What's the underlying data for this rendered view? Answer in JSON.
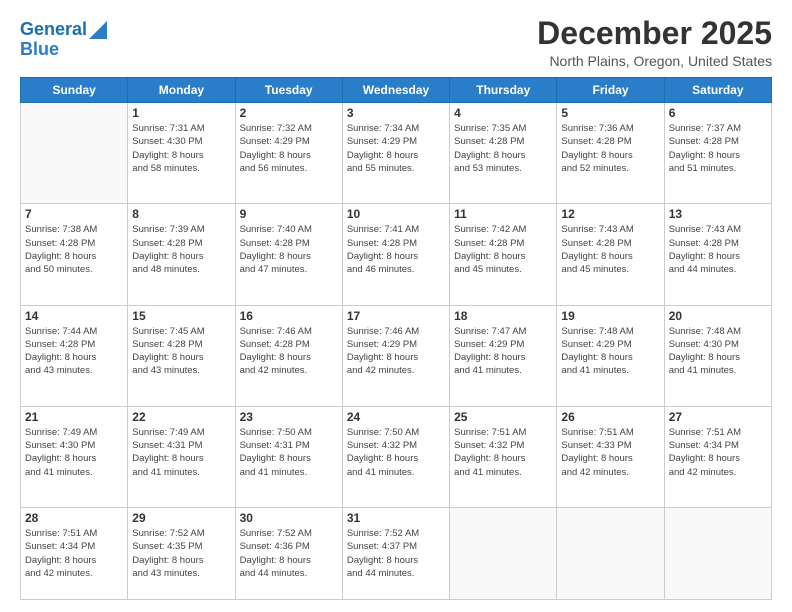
{
  "header": {
    "logo_line1": "General",
    "logo_line2": "Blue",
    "month": "December 2025",
    "location": "North Plains, Oregon, United States"
  },
  "days_of_week": [
    "Sunday",
    "Monday",
    "Tuesday",
    "Wednesday",
    "Thursday",
    "Friday",
    "Saturday"
  ],
  "weeks": [
    [
      {
        "day": "",
        "info": ""
      },
      {
        "day": "1",
        "info": "Sunrise: 7:31 AM\nSunset: 4:30 PM\nDaylight: 8 hours\nand 58 minutes."
      },
      {
        "day": "2",
        "info": "Sunrise: 7:32 AM\nSunset: 4:29 PM\nDaylight: 8 hours\nand 56 minutes."
      },
      {
        "day": "3",
        "info": "Sunrise: 7:34 AM\nSunset: 4:29 PM\nDaylight: 8 hours\nand 55 minutes."
      },
      {
        "day": "4",
        "info": "Sunrise: 7:35 AM\nSunset: 4:28 PM\nDaylight: 8 hours\nand 53 minutes."
      },
      {
        "day": "5",
        "info": "Sunrise: 7:36 AM\nSunset: 4:28 PM\nDaylight: 8 hours\nand 52 minutes."
      },
      {
        "day": "6",
        "info": "Sunrise: 7:37 AM\nSunset: 4:28 PM\nDaylight: 8 hours\nand 51 minutes."
      }
    ],
    [
      {
        "day": "7",
        "info": "Sunrise: 7:38 AM\nSunset: 4:28 PM\nDaylight: 8 hours\nand 50 minutes."
      },
      {
        "day": "8",
        "info": "Sunrise: 7:39 AM\nSunset: 4:28 PM\nDaylight: 8 hours\nand 48 minutes."
      },
      {
        "day": "9",
        "info": "Sunrise: 7:40 AM\nSunset: 4:28 PM\nDaylight: 8 hours\nand 47 minutes."
      },
      {
        "day": "10",
        "info": "Sunrise: 7:41 AM\nSunset: 4:28 PM\nDaylight: 8 hours\nand 46 minutes."
      },
      {
        "day": "11",
        "info": "Sunrise: 7:42 AM\nSunset: 4:28 PM\nDaylight: 8 hours\nand 45 minutes."
      },
      {
        "day": "12",
        "info": "Sunrise: 7:43 AM\nSunset: 4:28 PM\nDaylight: 8 hours\nand 45 minutes."
      },
      {
        "day": "13",
        "info": "Sunrise: 7:43 AM\nSunset: 4:28 PM\nDaylight: 8 hours\nand 44 minutes."
      }
    ],
    [
      {
        "day": "14",
        "info": "Sunrise: 7:44 AM\nSunset: 4:28 PM\nDaylight: 8 hours\nand 43 minutes."
      },
      {
        "day": "15",
        "info": "Sunrise: 7:45 AM\nSunset: 4:28 PM\nDaylight: 8 hours\nand 43 minutes."
      },
      {
        "day": "16",
        "info": "Sunrise: 7:46 AM\nSunset: 4:28 PM\nDaylight: 8 hours\nand 42 minutes."
      },
      {
        "day": "17",
        "info": "Sunrise: 7:46 AM\nSunset: 4:29 PM\nDaylight: 8 hours\nand 42 minutes."
      },
      {
        "day": "18",
        "info": "Sunrise: 7:47 AM\nSunset: 4:29 PM\nDaylight: 8 hours\nand 41 minutes."
      },
      {
        "day": "19",
        "info": "Sunrise: 7:48 AM\nSunset: 4:29 PM\nDaylight: 8 hours\nand 41 minutes."
      },
      {
        "day": "20",
        "info": "Sunrise: 7:48 AM\nSunset: 4:30 PM\nDaylight: 8 hours\nand 41 minutes."
      }
    ],
    [
      {
        "day": "21",
        "info": "Sunrise: 7:49 AM\nSunset: 4:30 PM\nDaylight: 8 hours\nand 41 minutes."
      },
      {
        "day": "22",
        "info": "Sunrise: 7:49 AM\nSunset: 4:31 PM\nDaylight: 8 hours\nand 41 minutes."
      },
      {
        "day": "23",
        "info": "Sunrise: 7:50 AM\nSunset: 4:31 PM\nDaylight: 8 hours\nand 41 minutes."
      },
      {
        "day": "24",
        "info": "Sunrise: 7:50 AM\nSunset: 4:32 PM\nDaylight: 8 hours\nand 41 minutes."
      },
      {
        "day": "25",
        "info": "Sunrise: 7:51 AM\nSunset: 4:32 PM\nDaylight: 8 hours\nand 41 minutes."
      },
      {
        "day": "26",
        "info": "Sunrise: 7:51 AM\nSunset: 4:33 PM\nDaylight: 8 hours\nand 42 minutes."
      },
      {
        "day": "27",
        "info": "Sunrise: 7:51 AM\nSunset: 4:34 PM\nDaylight: 8 hours\nand 42 minutes."
      }
    ],
    [
      {
        "day": "28",
        "info": "Sunrise: 7:51 AM\nSunset: 4:34 PM\nDaylight: 8 hours\nand 42 minutes."
      },
      {
        "day": "29",
        "info": "Sunrise: 7:52 AM\nSunset: 4:35 PM\nDaylight: 8 hours\nand 43 minutes."
      },
      {
        "day": "30",
        "info": "Sunrise: 7:52 AM\nSunset: 4:36 PM\nDaylight: 8 hours\nand 44 minutes."
      },
      {
        "day": "31",
        "info": "Sunrise: 7:52 AM\nSunset: 4:37 PM\nDaylight: 8 hours\nand 44 minutes."
      },
      {
        "day": "",
        "info": ""
      },
      {
        "day": "",
        "info": ""
      },
      {
        "day": "",
        "info": ""
      }
    ]
  ]
}
